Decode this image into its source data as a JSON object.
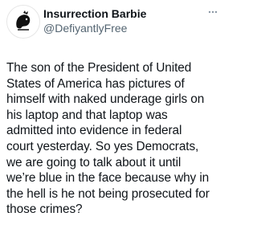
{
  "post": {
    "display_name": "Insurrection Barbie",
    "handle": "@DefiyantlyFree",
    "text": "The son of the President of United\nStates of America has pictures of\nhimself with naked underage girls on\nhis laptop and that laptop was\nadmitted into evidence in federal\ncourt yesterday. So yes Democrats,\nwe are going to talk about it until\nwe’re blue in the face because why in\nthe hell is he not being prosecuted for\nthose crimes?"
  },
  "icons": {
    "avatar": "avatar-logo",
    "more": "more-options-icon"
  },
  "colors": {
    "text": "#0f1419",
    "secondary": "#536471",
    "background": "#ffffff"
  }
}
